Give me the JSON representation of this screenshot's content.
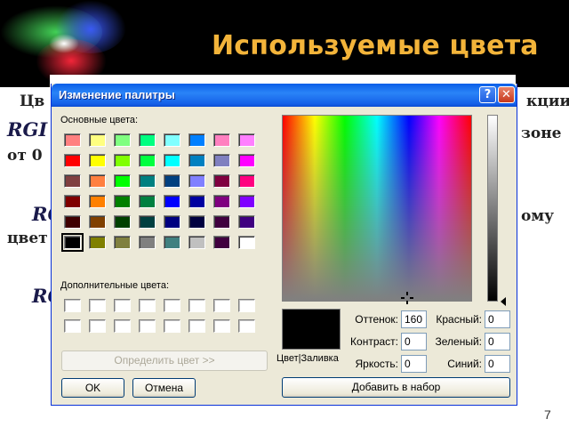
{
  "slide": {
    "title": "Используемые цвета",
    "text_lines": [
      {
        "text": "Цв",
        "style": "normal"
      },
      {
        "text": "кции",
        "style": "normal"
      },
      {
        "text": "RGI",
        "style": "big"
      },
      {
        "text": "зоне",
        "style": "normal"
      },
      {
        "text": "от 0",
        "style": "normal"
      },
      {
        "text": "RG",
        "style": "big"
      },
      {
        "text": "ому",
        "style": "normal"
      },
      {
        "text": "цвет",
        "style": "normal"
      },
      {
        "text": "RG",
        "style": "big"
      }
    ],
    "page_number": "7"
  },
  "dialog": {
    "title": "Изменение палитры",
    "help_label": "?",
    "close_label": "✕",
    "basic_colors_label": "Основные цвета:",
    "custom_colors_label": "Дополнительные цвета:",
    "define_button": "Определить цвет >>",
    "ok_button": "OK",
    "cancel_button": "Отмена",
    "add_button": "Добавить в набор",
    "preview_label": "Цвет|Заливка",
    "fields": {
      "hue": {
        "label": "Оттенок:",
        "value": "160"
      },
      "saturation": {
        "label": "Контраст:",
        "value": "0"
      },
      "luminance": {
        "label": "Яркость:",
        "value": "0"
      },
      "red": {
        "label": "Красный:",
        "value": "0"
      },
      "green": {
        "label": "Зеленый:",
        "value": "0"
      },
      "blue": {
        "label": "Синий:",
        "value": "0"
      }
    },
    "basic_colors": [
      [
        "#ff8080",
        "#ffff80",
        "#80ff80",
        "#00ff80",
        "#80ffff",
        "#0080ff",
        "#ff80c0",
        "#ff80ff"
      ],
      [
        "#ff0000",
        "#ffff00",
        "#80ff00",
        "#00ff40",
        "#00ffff",
        "#0080c0",
        "#8080c0",
        "#ff00ff"
      ],
      [
        "#804040",
        "#ff8040",
        "#00ff00",
        "#008080",
        "#004080",
        "#8080ff",
        "#800040",
        "#ff0080"
      ],
      [
        "#800000",
        "#ff8000",
        "#008000",
        "#008040",
        "#0000ff",
        "#0000a0",
        "#800080",
        "#8000ff"
      ],
      [
        "#400000",
        "#804000",
        "#004000",
        "#004040",
        "#000080",
        "#000040",
        "#400040",
        "#400080"
      ],
      [
        "#000000",
        "#808000",
        "#808040",
        "#808080",
        "#408080",
        "#c0c0c0",
        "#400040",
        "#ffffff"
      ]
    ],
    "selected_color": "#000000",
    "custom_colors": [
      [
        "#ffffff",
        "#ffffff",
        "#ffffff",
        "#ffffff",
        "#ffffff",
        "#ffffff",
        "#ffffff",
        "#ffffff"
      ],
      [
        "#ffffff",
        "#ffffff",
        "#ffffff",
        "#ffffff",
        "#ffffff",
        "#ffffff",
        "#ffffff",
        "#ffffff"
      ]
    ]
  }
}
